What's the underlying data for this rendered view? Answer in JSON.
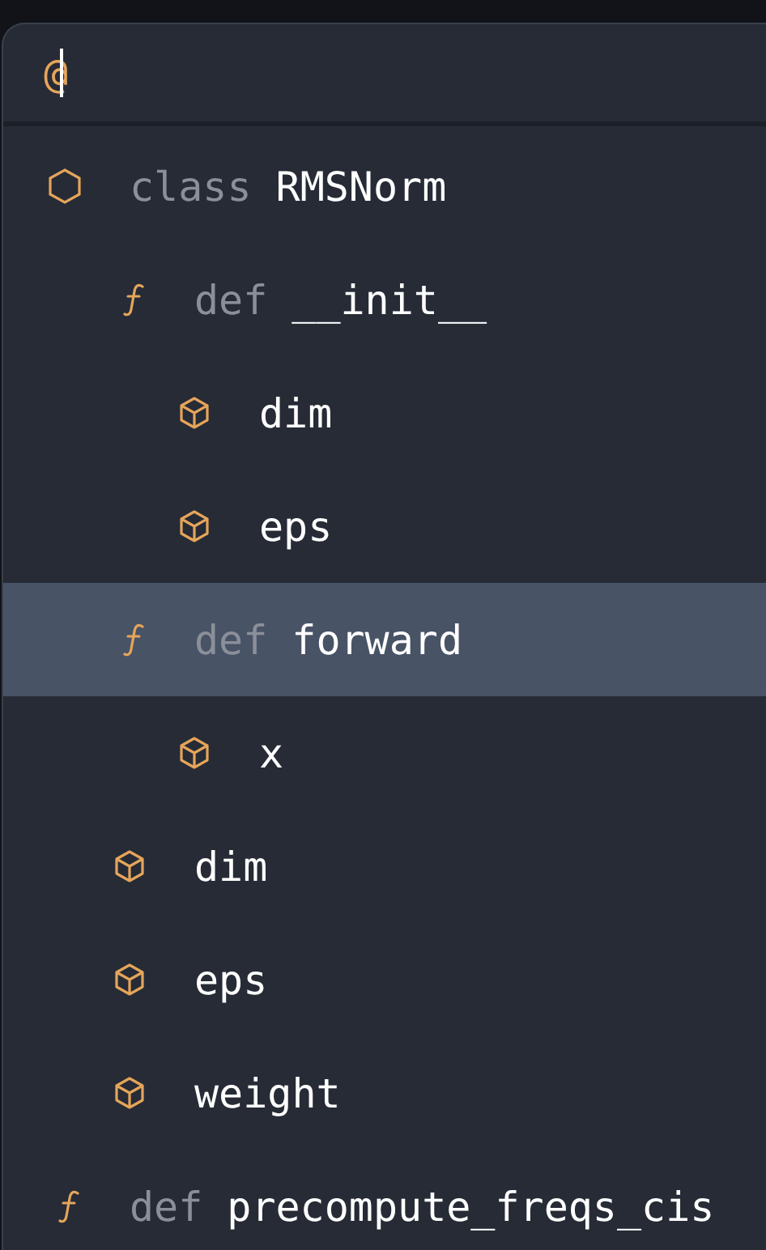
{
  "search": {
    "value": "@"
  },
  "symbols": [
    {
      "kind": "class",
      "keyword": "class",
      "name": "RMSNorm",
      "selected": false,
      "children": [
        {
          "kind": "function",
          "keyword": "def",
          "name": "__init__",
          "selected": false,
          "children": [
            {
              "kind": "field",
              "name": "dim",
              "selected": false
            },
            {
              "kind": "field",
              "name": "eps",
              "selected": false
            }
          ]
        },
        {
          "kind": "function",
          "keyword": "def",
          "name": "forward",
          "selected": true,
          "children": [
            {
              "kind": "field",
              "name": "x",
              "selected": false
            }
          ]
        },
        {
          "kind": "field",
          "name": "dim",
          "selected": false
        },
        {
          "kind": "field",
          "name": "eps",
          "selected": false
        },
        {
          "kind": "field",
          "name": "weight",
          "selected": false
        }
      ]
    },
    {
      "kind": "function",
      "keyword": "def",
      "name": "precompute_freqs_cis",
      "selected": false
    }
  ]
}
